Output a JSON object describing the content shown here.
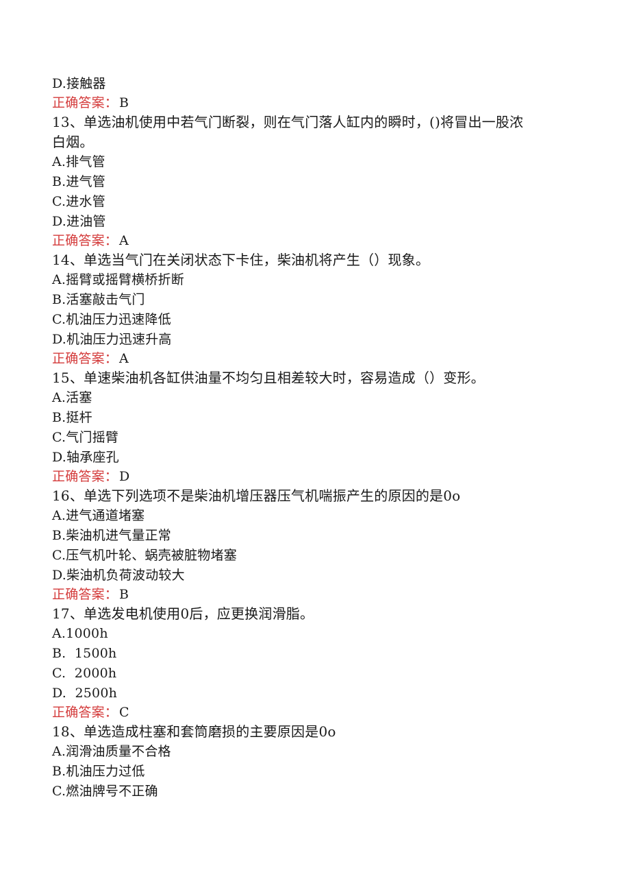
{
  "document": {
    "leading_lines": [
      {
        "type": "option",
        "text": "D.接触器"
      },
      {
        "type": "answer",
        "label": "正确答案：",
        "value": "B"
      }
    ],
    "questions": [
      {
        "number": "13",
        "stem": "13、单选油机使用中若气门断裂，则在气门落人缸内的瞬时，()将冒出一股浓白烟。",
        "options": [
          "A.排气管",
          "B.进气管",
          "C.进水管",
          "D.进油管"
        ],
        "answer_label": "正确答案：",
        "answer": "A"
      },
      {
        "number": "14",
        "stem": "14、单选当气门在关闭状态下卡住，柴油机将产生（）现象。",
        "options": [
          "A.摇臂或摇臂横桥折断",
          "B.活塞敲击气门",
          "C.机油压力迅速降低",
          "D.机油压力迅速升高"
        ],
        "answer_label": "正确答案：",
        "answer": "A"
      },
      {
        "number": "15",
        "stem": "15、单速柴油机各缸供油量不均匀且相差较大时，容易造成（）变形。",
        "options": [
          "A.活塞",
          "B.挺杆",
          "C.气门摇臂",
          "D.轴承座孔"
        ],
        "answer_label": "正确答案：",
        "answer": "D"
      },
      {
        "number": "16",
        "stem": "16、单选下列选项不是柴油机增压器压气机喘振产生的原因的是0o",
        "options": [
          "A.进气通道堵塞",
          "B.柴油机进气量正常",
          "C.压气机叶轮、蜗壳被脏物堵塞",
          "D.柴油机负荷波动较大"
        ],
        "answer_label": "正确答案：",
        "answer": "B"
      },
      {
        "number": "17",
        "stem": "17、单选发电机使用0后，应更换润滑脂。",
        "options": [
          "A.1000h",
          "B.  1500h",
          "C.  2000h",
          "D.  2500h"
        ],
        "answer_label": "正确答案：",
        "answer": "C"
      },
      {
        "number": "18",
        "stem": "18、单选造成柱塞和套筒磨损的主要原因是0o",
        "options": [
          "A.润滑油质量不合格",
          "B.机油压力过低",
          "C.燃油牌号不正确"
        ],
        "answer_label": null,
        "answer": null
      }
    ]
  }
}
